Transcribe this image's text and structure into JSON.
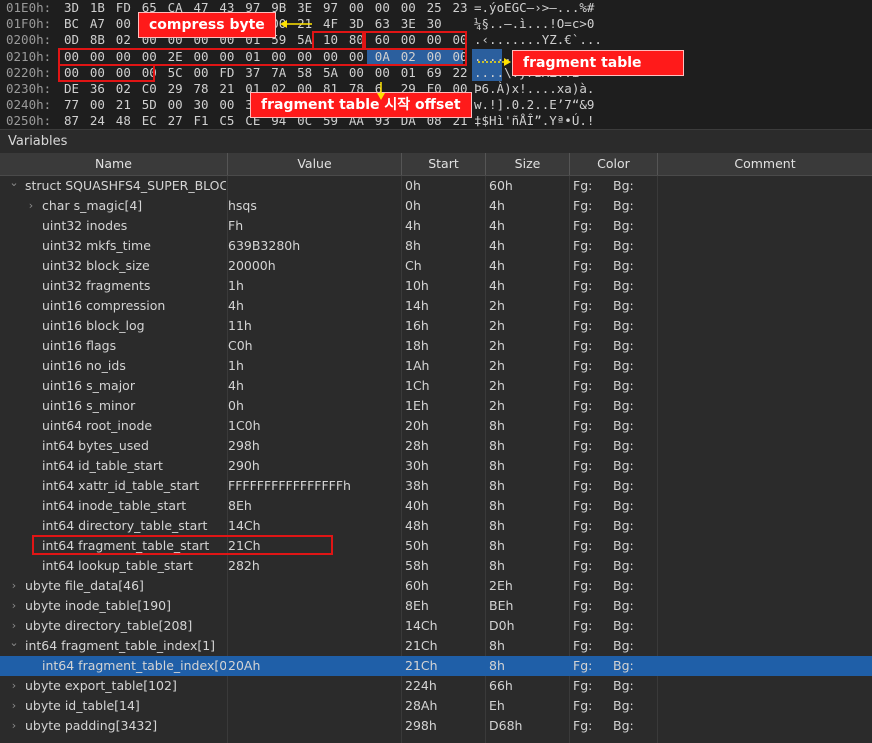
{
  "hex": {
    "rows": [
      {
        "addr": "01E0h:",
        "bytes": [
          "3D",
          "1B",
          "FD",
          "65",
          "CA",
          "47",
          "43",
          "97",
          "9B",
          "3E",
          "97",
          "00",
          "00",
          "00",
          "25",
          "23"
        ],
        "ascii": "=.ýoEGC–›>—...%#"
      },
      {
        "addr": "01F0h:",
        "bytes": [
          "BC",
          "A7",
          "00",
          "",
          "",
          "",
          "",
          "",
          "00",
          "21",
          "4F",
          "3D",
          "63",
          "3E",
          "30",
          ""
        ],
        "ascii": "¼§..–.ì...!O=c>0"
      },
      {
        "addr": "0200h:",
        "bytes": [
          "0D",
          "8B",
          "02",
          "00",
          "00",
          "00",
          "00",
          "01",
          "59",
          "5A",
          "10",
          "80",
          "60",
          "00",
          "00",
          "00"
        ],
        "ascii": ".‹.......YZ.€`..."
      },
      {
        "addr": "0210h:",
        "bytes": [
          "00",
          "00",
          "00",
          "00",
          "2E",
          "00",
          "00",
          "01",
          "00",
          "00",
          "00",
          "00",
          "0A",
          "02",
          "00",
          "00"
        ],
        "ascii": "................"
      },
      {
        "addr": "0220h:",
        "bytes": [
          "00",
          "00",
          "00",
          "00",
          "5C",
          "00",
          "FD",
          "37",
          "7A",
          "58",
          "5A",
          "00",
          "00",
          "01",
          "69",
          "22"
        ],
        "ascii": "....\\.ý7zXZ..i\""
      },
      {
        "addr": "0230h:",
        "bytes": [
          "DE",
          "36",
          "02",
          "C0",
          "29",
          "78",
          "21",
          "01",
          "02",
          "00",
          "81",
          "78",
          "6",
          "29",
          "F0",
          "00"
        ],
        "ascii": "Þ6.À)x!....xa)à."
      },
      {
        "addr": "0240h:",
        "bytes": [
          "77",
          "00",
          "21",
          "5D",
          "00",
          "30",
          "00",
          "3",
          "",
          "",
          "",
          "",
          "",
          "",
          "",
          ""
        ],
        "ascii": "w.!].0.2..E’7“&9"
      },
      {
        "addr": "0250h:",
        "bytes": [
          "87",
          "24",
          "48",
          "EC",
          "27",
          "F1",
          "C5",
          "CE",
          "94",
          "0C",
          "59",
          "AA",
          "93",
          "DA",
          "08",
          "21"
        ],
        "ascii": "‡$Hì'ñÅÎ”.Yª•Ú.!"
      }
    ],
    "callouts": {
      "compress_byte": "compress byte",
      "fragment_table": "fragment table",
      "fragment_table_offset": "fragment table 시작 offset"
    }
  },
  "panel": {
    "title": "Variables"
  },
  "columns": {
    "name": "Name",
    "value": "Value",
    "start": "Start",
    "size": "Size",
    "color": "Color",
    "comment": "Comment"
  },
  "rows": [
    {
      "name": "struct SQUASHFS4_SUPER_BLOC...",
      "value": "",
      "start": "0h",
      "size": "60h",
      "fg": "Fg:",
      "bg": "Bg:",
      "indent": 0,
      "tree": "v"
    },
    {
      "name": "char s_magic[4]",
      "value": "hsqs",
      "start": "0h",
      "size": "4h",
      "fg": "Fg:",
      "bg": "Bg:",
      "indent": 1,
      "tree": ">"
    },
    {
      "name": "uint32 inodes",
      "value": "Fh",
      "start": "4h",
      "size": "4h",
      "fg": "Fg:",
      "bg": "Bg:",
      "indent": 1,
      "tree": ""
    },
    {
      "name": "uint32 mkfs_time",
      "value": "639B3280h",
      "start": "8h",
      "size": "4h",
      "fg": "Fg:",
      "bg": "Bg:",
      "indent": 1,
      "tree": ""
    },
    {
      "name": "uint32 block_size",
      "value": "20000h",
      "start": "Ch",
      "size": "4h",
      "fg": "Fg:",
      "bg": "Bg:",
      "indent": 1,
      "tree": ""
    },
    {
      "name": "uint32 fragments",
      "value": "1h",
      "start": "10h",
      "size": "4h",
      "fg": "Fg:",
      "bg": "Bg:",
      "indent": 1,
      "tree": ""
    },
    {
      "name": "uint16 compression",
      "value": "4h",
      "start": "14h",
      "size": "2h",
      "fg": "Fg:",
      "bg": "Bg:",
      "indent": 1,
      "tree": ""
    },
    {
      "name": "uint16 block_log",
      "value": "11h",
      "start": "16h",
      "size": "2h",
      "fg": "Fg:",
      "bg": "Bg:",
      "indent": 1,
      "tree": ""
    },
    {
      "name": "uint16 flags",
      "value": "C0h",
      "start": "18h",
      "size": "2h",
      "fg": "Fg:",
      "bg": "Bg:",
      "indent": 1,
      "tree": ""
    },
    {
      "name": "uint16 no_ids",
      "value": "1h",
      "start": "1Ah",
      "size": "2h",
      "fg": "Fg:",
      "bg": "Bg:",
      "indent": 1,
      "tree": ""
    },
    {
      "name": "uint16 s_major",
      "value": "4h",
      "start": "1Ch",
      "size": "2h",
      "fg": "Fg:",
      "bg": "Bg:",
      "indent": 1,
      "tree": ""
    },
    {
      "name": "uint16 s_minor",
      "value": "0h",
      "start": "1Eh",
      "size": "2h",
      "fg": "Fg:",
      "bg": "Bg:",
      "indent": 1,
      "tree": ""
    },
    {
      "name": "uint64 root_inode",
      "value": "1C0h",
      "start": "20h",
      "size": "8h",
      "fg": "Fg:",
      "bg": "Bg:",
      "indent": 1,
      "tree": ""
    },
    {
      "name": "int64 bytes_used",
      "value": "298h",
      "start": "28h",
      "size": "8h",
      "fg": "Fg:",
      "bg": "Bg:",
      "indent": 1,
      "tree": ""
    },
    {
      "name": "int64 id_table_start",
      "value": "290h",
      "start": "30h",
      "size": "8h",
      "fg": "Fg:",
      "bg": "Bg:",
      "indent": 1,
      "tree": ""
    },
    {
      "name": "int64 xattr_id_table_start",
      "value": "FFFFFFFFFFFFFFFFh",
      "start": "38h",
      "size": "8h",
      "fg": "Fg:",
      "bg": "Bg:",
      "indent": 1,
      "tree": ""
    },
    {
      "name": "int64 inode_table_start",
      "value": "8Eh",
      "start": "40h",
      "size": "8h",
      "fg": "Fg:",
      "bg": "Bg:",
      "indent": 1,
      "tree": ""
    },
    {
      "name": "int64 directory_table_start",
      "value": "14Ch",
      "start": "48h",
      "size": "8h",
      "fg": "Fg:",
      "bg": "Bg:",
      "indent": 1,
      "tree": ""
    },
    {
      "name": "int64 fragment_table_start",
      "value": "21Ch",
      "start": "50h",
      "size": "8h",
      "fg": "Fg:",
      "bg": "Bg:",
      "indent": 1,
      "tree": ""
    },
    {
      "name": "int64 lookup_table_start",
      "value": "282h",
      "start": "58h",
      "size": "8h",
      "fg": "Fg:",
      "bg": "Bg:",
      "indent": 1,
      "tree": ""
    },
    {
      "name": "ubyte file_data[46]",
      "value": "",
      "start": "60h",
      "size": "2Eh",
      "fg": "Fg:",
      "bg": "Bg:",
      "indent": 0,
      "tree": ">"
    },
    {
      "name": "ubyte inode_table[190]",
      "value": "",
      "start": "8Eh",
      "size": "BEh",
      "fg": "Fg:",
      "bg": "Bg:",
      "indent": 0,
      "tree": ">"
    },
    {
      "name": "ubyte directory_table[208]",
      "value": "",
      "start": "14Ch",
      "size": "D0h",
      "fg": "Fg:",
      "bg": "Bg:",
      "indent": 0,
      "tree": ">"
    },
    {
      "name": "int64 fragment_table_index[1]",
      "value": "",
      "start": "21Ch",
      "size": "8h",
      "fg": "Fg:",
      "bg": "Bg:",
      "indent": 0,
      "tree": "v"
    },
    {
      "name": "int64 fragment_table_index[0]",
      "value": "20Ah",
      "start": "21Ch",
      "size": "8h",
      "fg": "Fg:",
      "bg": "Bg:",
      "indent": 1,
      "tree": "",
      "selected": true
    },
    {
      "name": "ubyte export_table[102]",
      "value": "",
      "start": "224h",
      "size": "66h",
      "fg": "Fg:",
      "bg": "Bg:",
      "indent": 0,
      "tree": ">"
    },
    {
      "name": "ubyte id_table[14]",
      "value": "",
      "start": "28Ah",
      "size": "Eh",
      "fg": "Fg:",
      "bg": "Bg:",
      "indent": 0,
      "tree": ">"
    },
    {
      "name": "ubyte padding[3432]",
      "value": "",
      "start": "298h",
      "size": "D68h",
      "fg": "Fg:",
      "bg": "Bg:",
      "indent": 0,
      "tree": ">"
    }
  ]
}
